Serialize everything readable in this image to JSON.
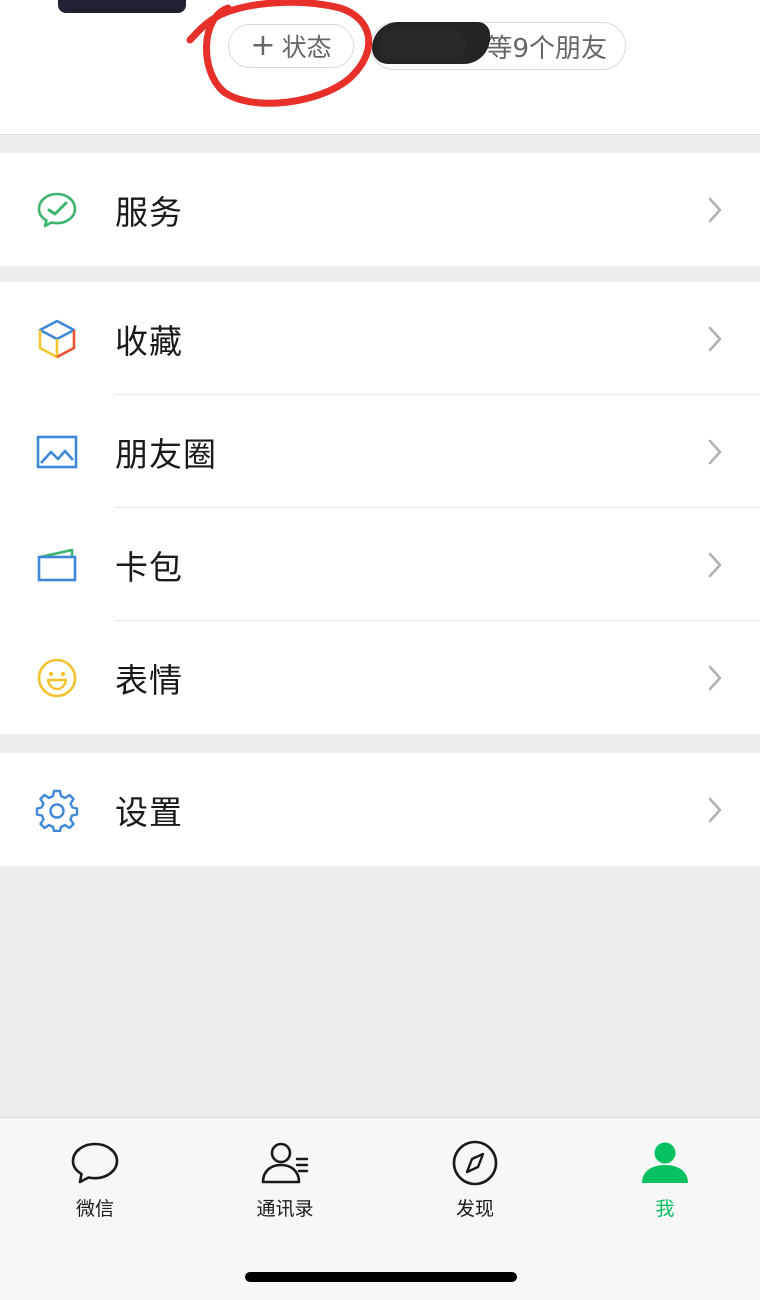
{
  "profile": {
    "status_plus": "+",
    "status_label": "状态",
    "friends_text": "等9个朋友"
  },
  "menu": {
    "group1": [
      {
        "label": "服务",
        "icon": "services-icon"
      }
    ],
    "group2": [
      {
        "label": "收藏",
        "icon": "favorites-cube-icon"
      },
      {
        "label": "朋友圈",
        "icon": "moments-photo-icon"
      },
      {
        "label": "卡包",
        "icon": "card-wallet-icon"
      },
      {
        "label": "表情",
        "icon": "smiley-icon"
      }
    ],
    "group3": [
      {
        "label": "设置",
        "icon": "gear-icon"
      }
    ]
  },
  "tabbar": {
    "tabs": [
      {
        "label": "微信",
        "icon": "chat-bubble-icon",
        "active": false
      },
      {
        "label": "通讯录",
        "icon": "contacts-icon",
        "active": false
      },
      {
        "label": "发现",
        "icon": "compass-icon",
        "active": false
      },
      {
        "label": "我",
        "icon": "person-icon",
        "active": true
      }
    ]
  },
  "colors": {
    "accent_green": "#07c160",
    "annotation_red": "#e8302a",
    "background": "#ededed"
  }
}
